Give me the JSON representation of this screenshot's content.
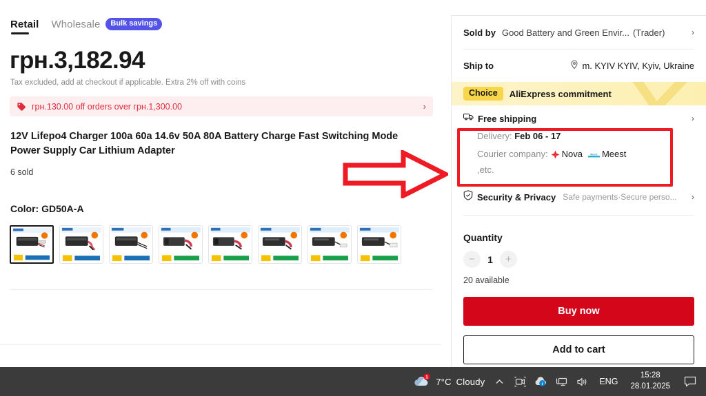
{
  "tabs": {
    "retail": "Retail",
    "wholesale": "Wholesale",
    "bulk_badge": "Bulk savings"
  },
  "price": {
    "amount": "грн.3,182.94",
    "tax_note": "Tax excluded, add at checkout if applicable. Extra 2% off with coins"
  },
  "coupon": {
    "text": "грн.130.00 off orders over грн.1,300.00",
    "chevron": "›"
  },
  "product": {
    "title": "12V Lifepo4 Charger 100a 60a 14.6v 50A 80A Battery Charge Fast Switching Mode Power Supply Car Lithium Adapter",
    "sold": "6 sold",
    "color_label": "Color: GD50A-A"
  },
  "thumbnails": [
    {
      "name": "thumb-gd50a-a",
      "selected": true
    },
    {
      "name": "thumb-gd50a-b",
      "selected": false
    },
    {
      "name": "thumb-gd50a-c",
      "selected": false
    },
    {
      "name": "thumb-gd60a-a",
      "selected": false
    },
    {
      "name": "thumb-gd60a-b",
      "selected": false
    },
    {
      "name": "thumb-gd80a-a",
      "selected": false
    },
    {
      "name": "thumb-gd80a-b",
      "selected": false
    },
    {
      "name": "thumb-gd100a-a",
      "selected": false
    }
  ],
  "seller": {
    "sold_by_label": "Sold by",
    "sold_by_value": "Good Battery and Green Envir...",
    "trader": "(Trader)",
    "chevron": "›"
  },
  "shipping": {
    "ship_to_label": "Ship to",
    "ship_to_value": "m. KYIV KYIV, Kyiv, Ukraine",
    "choice_pill": "Choice",
    "choice_text": "AliExpress commitment",
    "free_shipping": "Free shipping",
    "free_shipping_chevron": "›",
    "delivery_label": "Delivery:",
    "delivery_value": "Feb 06 - 17",
    "courier_label": "Courier company:",
    "courier_1": "Nova",
    "courier_2": "Meest",
    "courier_etc": ",etc."
  },
  "security": {
    "title": "Security & Privacy",
    "subtitle": "Safe payments·Secure perso...",
    "chevron": "›"
  },
  "quantity": {
    "title": "Quantity",
    "minus": "−",
    "value": "1",
    "plus": "+",
    "available": "20 available"
  },
  "actions": {
    "buy_now": "Buy now",
    "add_to_cart": "Add to cart"
  },
  "taskbar": {
    "weather_temp": "7°C",
    "weather_desc": "Cloudy",
    "weather_badge": "1",
    "language": "ENG",
    "time": "15:28",
    "date": "28.01.2025"
  },
  "colors": {
    "accent_red": "#d3061a",
    "coupon_red": "#e02c3f",
    "coupon_bg": "#fdeef0",
    "badge_purple": "#5353e8",
    "choice_yellow": "#f7d64a",
    "annotation_red": "#ef1b24",
    "taskbar_bg": "#3b3b3b"
  }
}
